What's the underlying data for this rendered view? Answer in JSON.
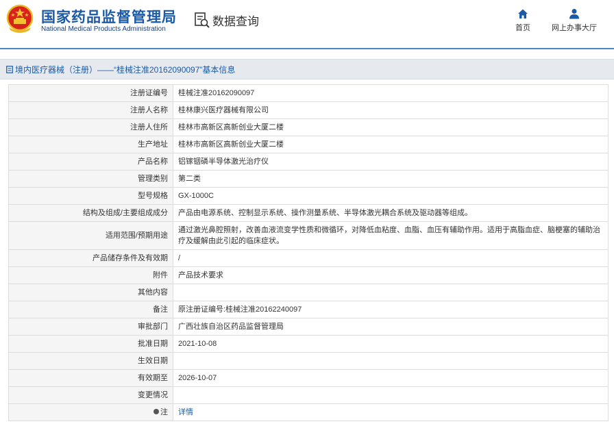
{
  "header": {
    "title_cn": "国家药品监督管理局",
    "title_en": "National Medical Products Administration",
    "section_title": "数据查询",
    "nav": [
      {
        "label": "首页",
        "icon": "home-icon"
      },
      {
        "label": "网上办事大厅",
        "icon": "user-icon"
      }
    ]
  },
  "breadcrumb": "境内医疗器械（注册）——“桂械注准20162090097”基本信息",
  "colors": {
    "brand_blue": "#1a5aa6",
    "divider": "#4a86c8",
    "label_bg": "#f5f5f5",
    "crumb_bg": "#e6eaef"
  },
  "rows": [
    {
      "label": "注册证编号",
      "value": "桂械注准20162090097"
    },
    {
      "label": "注册人名称",
      "value": "桂林康兴医疗器械有限公司"
    },
    {
      "label": "注册人住所",
      "value": "桂林市高新区高新创业大厦二楼"
    },
    {
      "label": "生产地址",
      "value": "桂林市高新区高新创业大厦二楼"
    },
    {
      "label": "产品名称",
      "value": "铝镓铟磷半导体激光治疗仪"
    },
    {
      "label": "管理类别",
      "value": "第二类"
    },
    {
      "label": "型号规格",
      "value": "GX-1000C"
    },
    {
      "label": "结构及组成/主要组成成分",
      "value": "产品由电源系统、控制显示系统、操作测量系统、半导体激光耦合系统及驱动器等组成。"
    },
    {
      "label": "适用范围/预期用途",
      "value": "通过激光鼻腔照射，改善血液流变学性质和微循环，对降低血粘度、血脂、血压有辅助作用。适用于高脂血症、脑梗塞的辅助治疗及缓解由此引起的临床症状。"
    },
    {
      "label": "产品储存条件及有效期",
      "value": "/"
    },
    {
      "label": "附件",
      "value": "产品技术要求"
    },
    {
      "label": "其他内容",
      "value": ""
    },
    {
      "label": "备注",
      "value": "原注册证编号:桂械注准20162240097"
    },
    {
      "label": "审批部门",
      "value": "广西壮族自治区药品监督管理局"
    },
    {
      "label": "批准日期",
      "value": "2021-10-08"
    },
    {
      "label": "生效日期",
      "value": ""
    },
    {
      "label": "有效期至",
      "value": "2026-10-07"
    },
    {
      "label": "变更情况",
      "value": ""
    },
    {
      "label": "注",
      "value": "详情"
    }
  ]
}
